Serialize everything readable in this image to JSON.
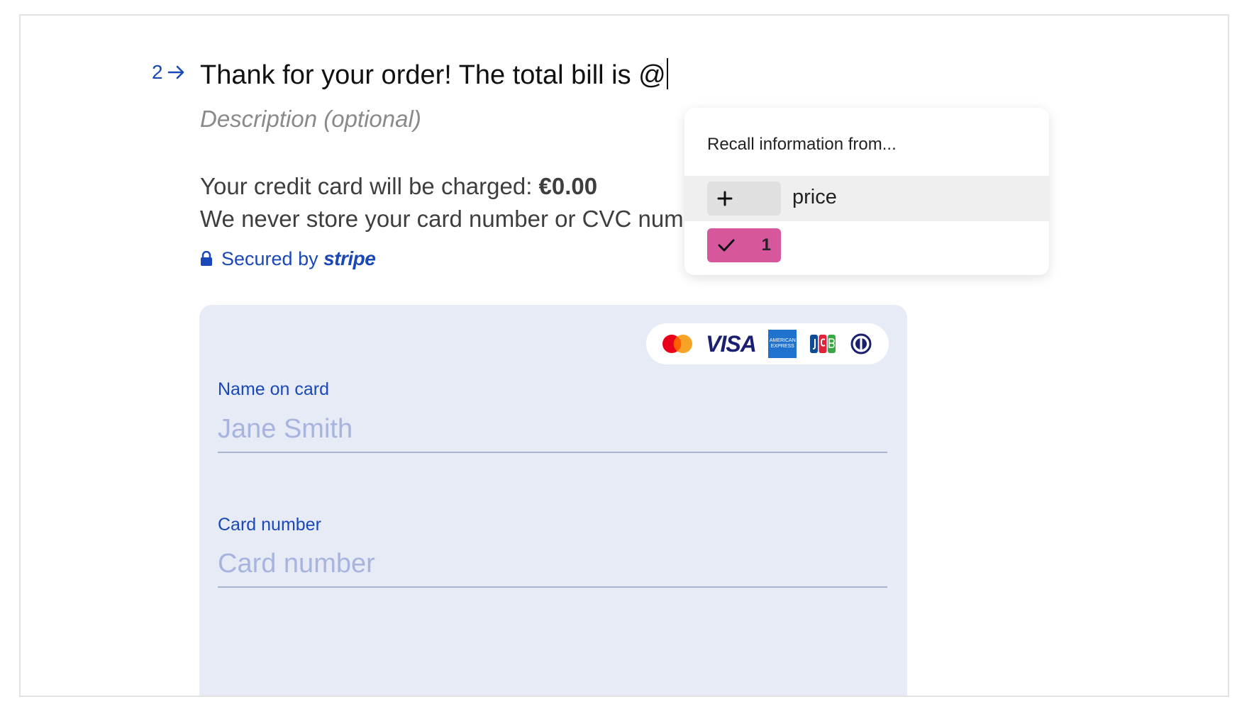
{
  "question": {
    "number": "2",
    "title": "Thank for your order! The total bill is @",
    "description_placeholder": "Description (optional)"
  },
  "payment": {
    "charge_prefix": "Your credit card will be charged: ",
    "charge_amount": "€0.00",
    "store_note": "We never store your card number or CVC number.",
    "secured_by": "Secured by",
    "provider": "stripe"
  },
  "card_form": {
    "brands": [
      "mastercard-icon",
      "visa-icon",
      "amex-icon",
      "jcb-icon",
      "diners-icon"
    ],
    "visa_text": "VISA",
    "amex_text": "AMERICAN EXPRESS",
    "name_label": "Name on card",
    "name_placeholder": "Jane Smith",
    "number_label": "Card number",
    "number_placeholder": "Card number"
  },
  "recall_popup": {
    "title": "Recall information from...",
    "items": [
      {
        "icon": "plus-icon",
        "label": "price"
      },
      {
        "icon": "check-icon",
        "label": "1"
      }
    ]
  },
  "colors": {
    "accent_blue": "#1a48b8",
    "panel_bg": "#e7ebf5",
    "pink": "#d6579c"
  }
}
